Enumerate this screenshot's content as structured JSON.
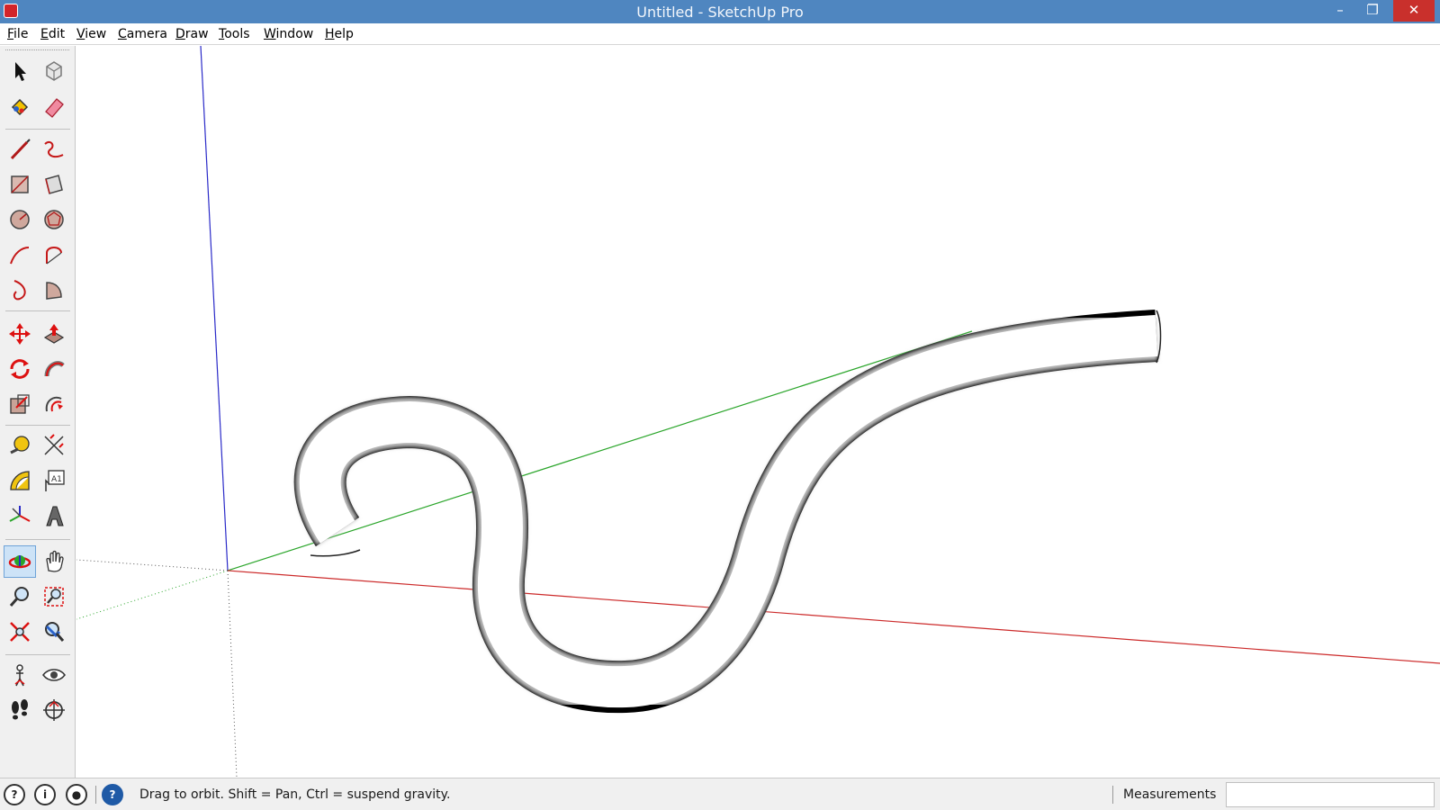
{
  "window": {
    "title": "Untitled - SketchUp Pro",
    "minimize": "–",
    "restore": "❐",
    "close": "✕"
  },
  "menu": [
    "File",
    "Edit",
    "View",
    "Camera",
    "Draw",
    "Tools",
    "Window",
    "Help"
  ],
  "toolbar": {
    "tools": [
      {
        "name": "select-tool-icon"
      },
      {
        "name": "make-component-icon"
      },
      {
        "name": "paint-bucket-icon"
      },
      {
        "name": "eraser-icon"
      },
      {
        "name": "line-tool-icon"
      },
      {
        "name": "freehand-tool-icon"
      },
      {
        "name": "rectangle-tool-icon"
      },
      {
        "name": "rotated-rectangle-icon"
      },
      {
        "name": "circle-tool-icon"
      },
      {
        "name": "polygon-tool-icon"
      },
      {
        "name": "arc-tool-icon"
      },
      {
        "name": "two-point-arc-icon"
      },
      {
        "name": "three-point-arc-icon"
      },
      {
        "name": "pie-tool-icon"
      },
      {
        "name": "move-tool-icon"
      },
      {
        "name": "push-pull-icon"
      },
      {
        "name": "rotate-tool-icon"
      },
      {
        "name": "follow-me-icon"
      },
      {
        "name": "scale-tool-icon"
      },
      {
        "name": "offset-tool-icon"
      },
      {
        "name": "tape-measure-icon"
      },
      {
        "name": "dimension-tool-icon"
      },
      {
        "name": "protractor-icon"
      },
      {
        "name": "text-tool-icon"
      },
      {
        "name": "axes-tool-icon"
      },
      {
        "name": "3d-text-icon"
      },
      {
        "name": "orbit-tool-icon",
        "active": true
      },
      {
        "name": "pan-tool-icon"
      },
      {
        "name": "zoom-tool-icon"
      },
      {
        "name": "zoom-window-icon"
      },
      {
        "name": "zoom-extents-icon"
      },
      {
        "name": "previous-view-icon"
      },
      {
        "name": "position-camera-icon"
      },
      {
        "name": "look-around-icon"
      },
      {
        "name": "walk-tool-icon"
      },
      {
        "name": "section-plane-icon"
      }
    ]
  },
  "colors": {
    "titlebar": "#4f86c0",
    "axis_red": "#cc2a2a",
    "axis_green": "#2aa52a",
    "axis_blue": "#2a2ac8"
  },
  "status": {
    "message": "Drag to orbit. Shift = Pan, Ctrl = suspend gravity.",
    "measurements_label": "Measurements",
    "measurements_value": ""
  }
}
